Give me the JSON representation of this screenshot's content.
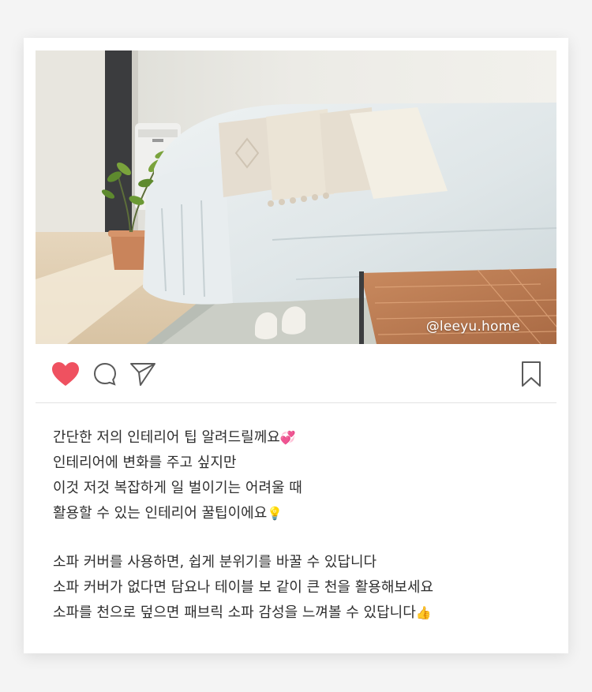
{
  "post": {
    "watermark": "@leeyu.home",
    "photo_alt": "sofa-with-white-cover",
    "actions": {
      "like_icon": "heart-icon",
      "comment_icon": "comment-icon",
      "share_icon": "send-icon",
      "save_icon": "bookmark-icon",
      "liked": true
    },
    "colors": {
      "heart": "#ef5160",
      "icon_stroke": "#5a5a5a",
      "divider": "#e3e3e3"
    },
    "caption": {
      "line1": "간단한 저의 인테리어 팁 알려드릴께요",
      "line1_emoji": "💞",
      "line2": "인테리어에 변화를 주고 싶지만",
      "line3": "이것 저것 복잡하게 일 벌이기는 어려울 때",
      "line4": "활용할 수 있는 인테리어 꿀팁이에요",
      "line4_emoji": "💡",
      "line5": "소파 커버를 사용하면, 쉽게 분위기를 바꿀 수 있답니다",
      "line6": "소파 커버가 없다면 담요나 테이블 보 같이 큰 천을 활용해보세요",
      "line7": "소파를 천으로 덮으면 패브릭 소파 감성을 느껴볼 수 있답니다",
      "line7_emoji": "👍"
    }
  }
}
